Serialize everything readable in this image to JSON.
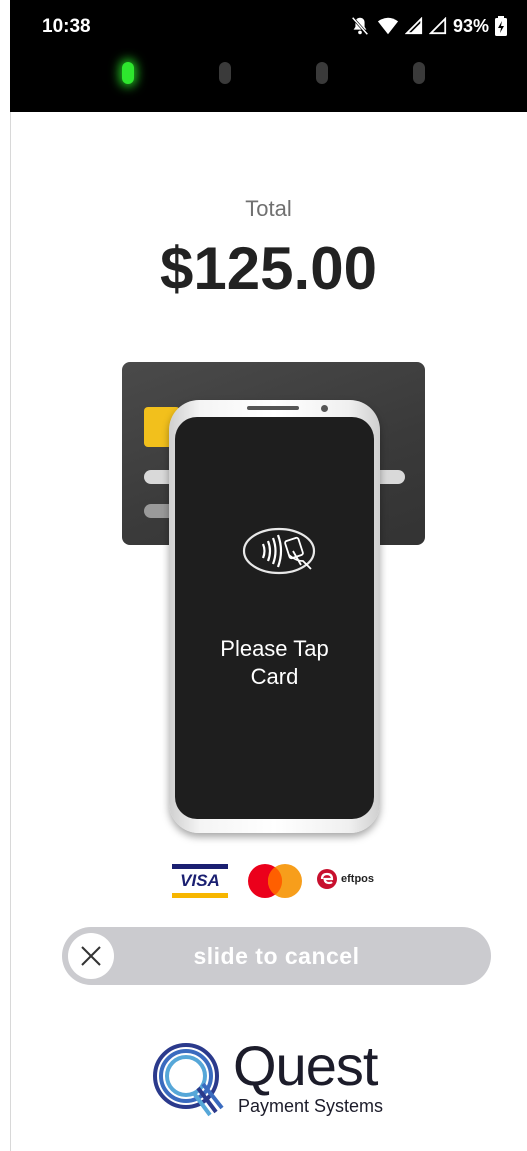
{
  "status_bar": {
    "time": "10:38",
    "battery_percent": "93%",
    "icons": [
      "bell-off-icon",
      "wifi-icon",
      "signal-icon",
      "signal-icon",
      "battery-charging-icon"
    ]
  },
  "leds": {
    "active_index": 0,
    "count": 4,
    "active_color": "#2ee62e"
  },
  "payment": {
    "total_label": "Total",
    "total_amount": "$125.00",
    "instruction": "Please Tap Card"
  },
  "card_brands": {
    "visa": "VISA",
    "eftpos": "eftpos",
    "items": [
      "visa-logo",
      "mastercard-logo",
      "eftpos-logo"
    ]
  },
  "cancel_slider": {
    "label": "slide to cancel",
    "icon": "close-icon"
  },
  "brand": {
    "name": "Quest",
    "tagline": "Payment Systems"
  }
}
